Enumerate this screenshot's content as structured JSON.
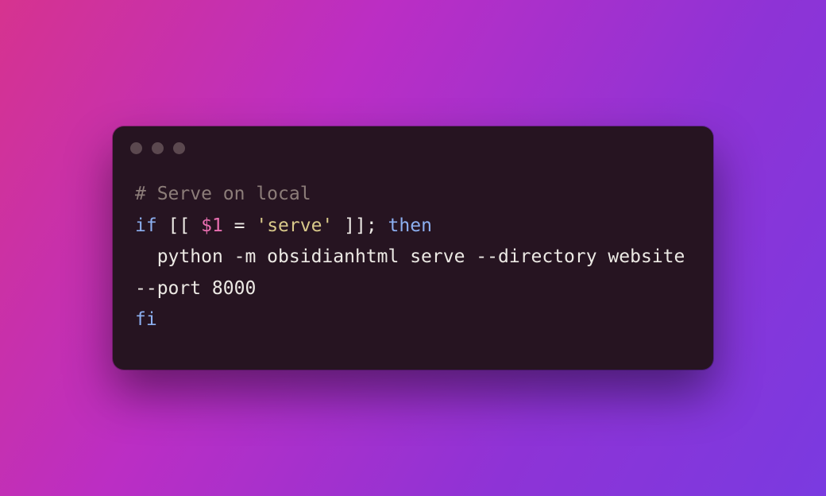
{
  "titlebar": {
    "dots": [
      "close",
      "minimize",
      "zoom"
    ]
  },
  "code": {
    "lines": [
      [
        {
          "cls": "comment",
          "t": "# Serve on local"
        }
      ],
      [
        {
          "cls": "keyword",
          "t": "if"
        },
        {
          "cls": "default",
          "t": " [[ "
        },
        {
          "cls": "var",
          "t": "$1"
        },
        {
          "cls": "default",
          "t": " = "
        },
        {
          "cls": "string",
          "t": "'serve'"
        },
        {
          "cls": "default",
          "t": " ]]; "
        },
        {
          "cls": "keyword",
          "t": "then"
        }
      ],
      [
        {
          "cls": "default",
          "t": "  python -m obsidianhtml serve --directory website --port 8000"
        }
      ],
      [
        {
          "cls": "keyword",
          "t": "fi"
        }
      ]
    ]
  }
}
